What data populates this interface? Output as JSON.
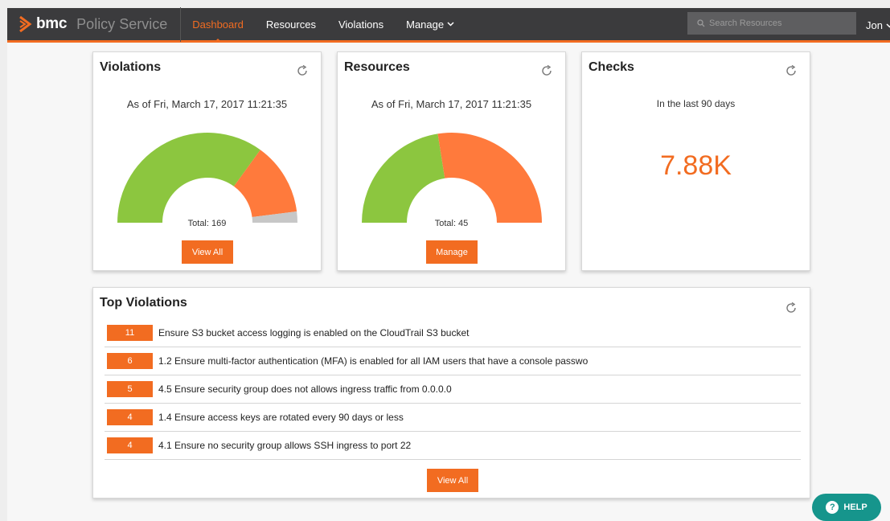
{
  "colors": {
    "accent": "#f26c21",
    "ok": "#8cc63f",
    "other": "#c7c7c7",
    "topbar": "#3b3b3d",
    "help": "#16958c"
  },
  "header": {
    "logo_text": "bmc",
    "app_title": "Policy Service",
    "nav": [
      "Dashboard",
      "Resources",
      "Violations",
      "Manage"
    ],
    "active_nav": "Dashboard",
    "search_placeholder": "Search Resources",
    "user": "Jon"
  },
  "violations_card": {
    "title": "Violations",
    "as_of": "As of Fri, March 17, 2017 11:21:35",
    "total_label": "Total: 169",
    "button": "View All",
    "gauge_segments": [
      {
        "color": "#8cc63f",
        "value": 0.7
      },
      {
        "color": "#ff7a3c",
        "value": 0.26
      },
      {
        "color": "#c7c7c7",
        "value": 0.04
      }
    ]
  },
  "resources_card": {
    "title": "Resources",
    "as_of": "As of Fri, March 17, 2017 11:21:35",
    "total_label": "Total: 45",
    "button": "Manage",
    "gauge_segments": [
      {
        "color": "#8cc63f",
        "value": 0.45
      },
      {
        "color": "#ff7a3c",
        "value": 0.55
      }
    ]
  },
  "checks_card": {
    "title": "Checks",
    "period": "In the last 90 days",
    "value": "7.88K"
  },
  "top_violations": {
    "title": "Top Violations",
    "button": "View All",
    "rows": [
      {
        "count": "11",
        "text": "Ensure S3 bucket access logging is enabled on the CloudTrail S3 bucket"
      },
      {
        "count": "6",
        "text": "1.2 Ensure multi-factor authentication (MFA) is enabled for all IAM users that have a console passwo"
      },
      {
        "count": "5",
        "text": "4.5 Ensure security group does not allows ingress traffic from 0.0.0.0"
      },
      {
        "count": "4",
        "text": "1.4 Ensure access keys are rotated every 90 days or less"
      },
      {
        "count": "4",
        "text": "4.1 Ensure no security group allows SSH ingress to port 22"
      }
    ]
  },
  "help_label": "HELP"
}
